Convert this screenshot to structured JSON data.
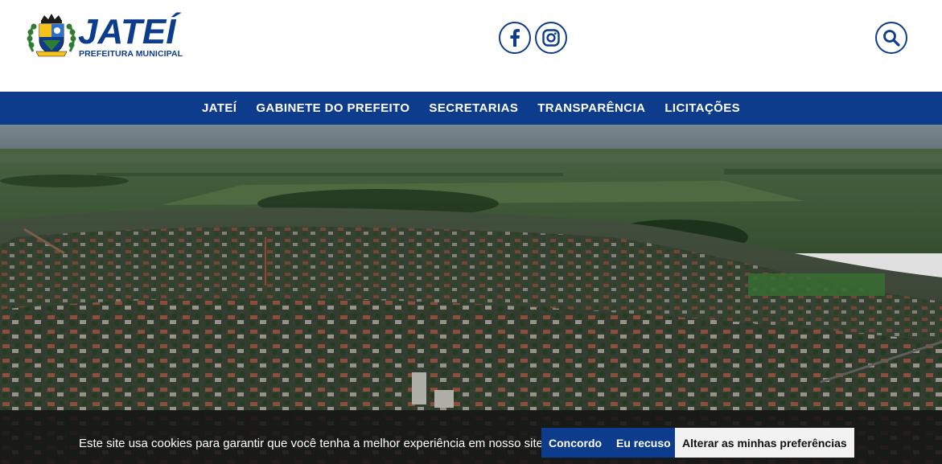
{
  "header": {
    "logo_title": "JATEÍ",
    "logo_subtitle": "PREFEITURA MUNICIPAL",
    "social": [
      {
        "icon": "facebook-icon"
      },
      {
        "icon": "instagram-icon"
      }
    ],
    "search_icon": "search-icon"
  },
  "nav": {
    "items": [
      {
        "label": "JATEÍ"
      },
      {
        "label": "GABINETE DO PREFEITO"
      },
      {
        "label": "SECRETARIAS"
      },
      {
        "label": "TRANSPARÊNCIA"
      },
      {
        "label": "LICITAÇÕES"
      }
    ]
  },
  "cookie_banner": {
    "message": "Este site usa cookies para garantir que você tenha a melhor experiência em nosso site.",
    "agree_label": "Concordo",
    "refuse_label": "Eu recuso",
    "preferences_label": "Alterar as minhas preferências"
  },
  "colors": {
    "brand_blue": "#0d3c8c",
    "nav_text": "#ffffff",
    "cookie_bg": "#161616"
  }
}
